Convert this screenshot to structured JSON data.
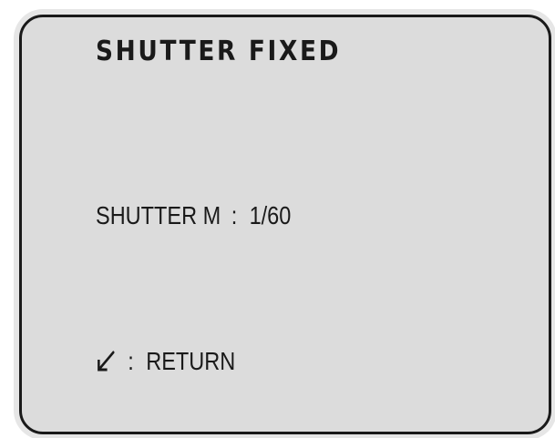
{
  "menu": {
    "title": "SHUTTER FIXED",
    "shutter_row": {
      "label": "SHUTTER M",
      "separator": ":",
      "value": "1/60"
    },
    "return_row": {
      "icon": "enter-arrow-icon",
      "separator": ":",
      "label": "RETURN"
    }
  },
  "colors": {
    "panel_background": "#dcdcdc",
    "frame": "#1a1a1a",
    "text": "#1a1a1a"
  }
}
